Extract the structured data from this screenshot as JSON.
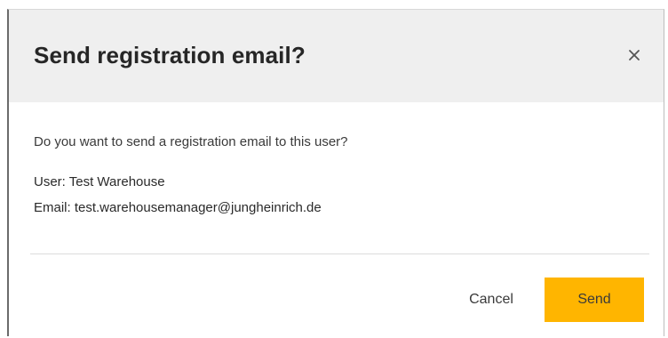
{
  "dialog": {
    "title": "Send registration email?",
    "close_icon": "close-icon",
    "question": "Do you want to send a registration email to this user?",
    "user_line": "User: Test Warehouse",
    "email_line": "Email: test.warehousemanager@jungheinrich.de",
    "cancel_label": "Cancel",
    "send_label": "Send"
  },
  "colors": {
    "header_background": "#efefef",
    "accent": "#ffb500",
    "text": "#262626"
  }
}
